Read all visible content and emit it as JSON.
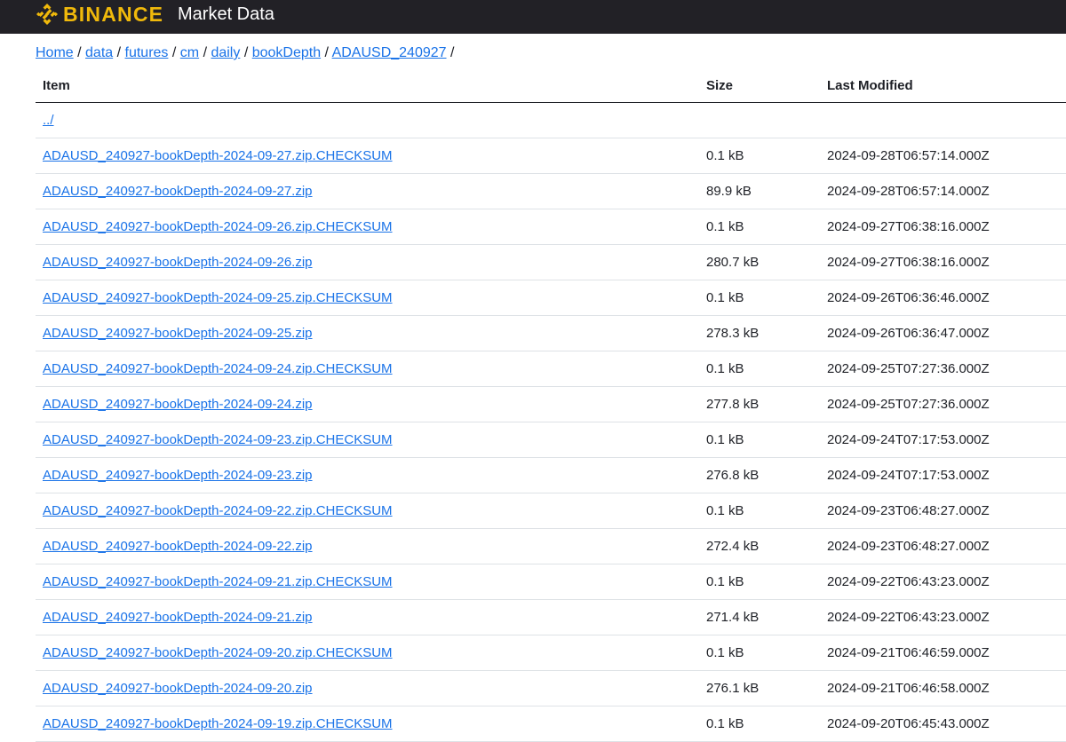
{
  "header": {
    "brand": "BINANCE",
    "app_title": "Market Data",
    "brand_color": "#F0B90B",
    "logo_icon": "binance-diamond-icon"
  },
  "breadcrumb": [
    {
      "label": "Home"
    },
    {
      "label": "data"
    },
    {
      "label": "futures"
    },
    {
      "label": "cm"
    },
    {
      "label": "daily"
    },
    {
      "label": "bookDepth"
    },
    {
      "label": "ADAUSD_240927"
    }
  ],
  "breadcrumb_separator": "/",
  "table": {
    "headers": {
      "item": "Item",
      "size": "Size",
      "modified": "Last Modified"
    },
    "parent": "../",
    "rows": [
      {
        "name": "ADAUSD_240927-bookDepth-2024-09-27.zip.CHECKSUM",
        "size": "0.1 kB",
        "modified": "2024-09-28T06:57:14.000Z"
      },
      {
        "name": "ADAUSD_240927-bookDepth-2024-09-27.zip",
        "size": "89.9 kB",
        "modified": "2024-09-28T06:57:14.000Z"
      },
      {
        "name": "ADAUSD_240927-bookDepth-2024-09-26.zip.CHECKSUM",
        "size": "0.1 kB",
        "modified": "2024-09-27T06:38:16.000Z"
      },
      {
        "name": "ADAUSD_240927-bookDepth-2024-09-26.zip",
        "size": "280.7 kB",
        "modified": "2024-09-27T06:38:16.000Z"
      },
      {
        "name": "ADAUSD_240927-bookDepth-2024-09-25.zip.CHECKSUM",
        "size": "0.1 kB",
        "modified": "2024-09-26T06:36:46.000Z"
      },
      {
        "name": "ADAUSD_240927-bookDepth-2024-09-25.zip",
        "size": "278.3 kB",
        "modified": "2024-09-26T06:36:47.000Z"
      },
      {
        "name": "ADAUSD_240927-bookDepth-2024-09-24.zip.CHECKSUM",
        "size": "0.1 kB",
        "modified": "2024-09-25T07:27:36.000Z"
      },
      {
        "name": "ADAUSD_240927-bookDepth-2024-09-24.zip",
        "size": "277.8 kB",
        "modified": "2024-09-25T07:27:36.000Z"
      },
      {
        "name": "ADAUSD_240927-bookDepth-2024-09-23.zip.CHECKSUM",
        "size": "0.1 kB",
        "modified": "2024-09-24T07:17:53.000Z"
      },
      {
        "name": "ADAUSD_240927-bookDepth-2024-09-23.zip",
        "size": "276.8 kB",
        "modified": "2024-09-24T07:17:53.000Z"
      },
      {
        "name": "ADAUSD_240927-bookDepth-2024-09-22.zip.CHECKSUM",
        "size": "0.1 kB",
        "modified": "2024-09-23T06:48:27.000Z"
      },
      {
        "name": "ADAUSD_240927-bookDepth-2024-09-22.zip",
        "size": "272.4 kB",
        "modified": "2024-09-23T06:48:27.000Z"
      },
      {
        "name": "ADAUSD_240927-bookDepth-2024-09-21.zip.CHECKSUM",
        "size": "0.1 kB",
        "modified": "2024-09-22T06:43:23.000Z"
      },
      {
        "name": "ADAUSD_240927-bookDepth-2024-09-21.zip",
        "size": "271.4 kB",
        "modified": "2024-09-22T06:43:23.000Z"
      },
      {
        "name": "ADAUSD_240927-bookDepth-2024-09-20.zip.CHECKSUM",
        "size": "0.1 kB",
        "modified": "2024-09-21T06:46:59.000Z"
      },
      {
        "name": "ADAUSD_240927-bookDepth-2024-09-20.zip",
        "size": "276.1 kB",
        "modified": "2024-09-21T06:46:58.000Z"
      },
      {
        "name": "ADAUSD_240927-bookDepth-2024-09-19.zip.CHECKSUM",
        "size": "0.1 kB",
        "modified": "2024-09-20T06:45:43.000Z"
      }
    ]
  },
  "colors": {
    "header_bg": "#222126",
    "link": "#1A73E8",
    "text": "#1E2026",
    "row_divider": "#DEE2E6"
  }
}
